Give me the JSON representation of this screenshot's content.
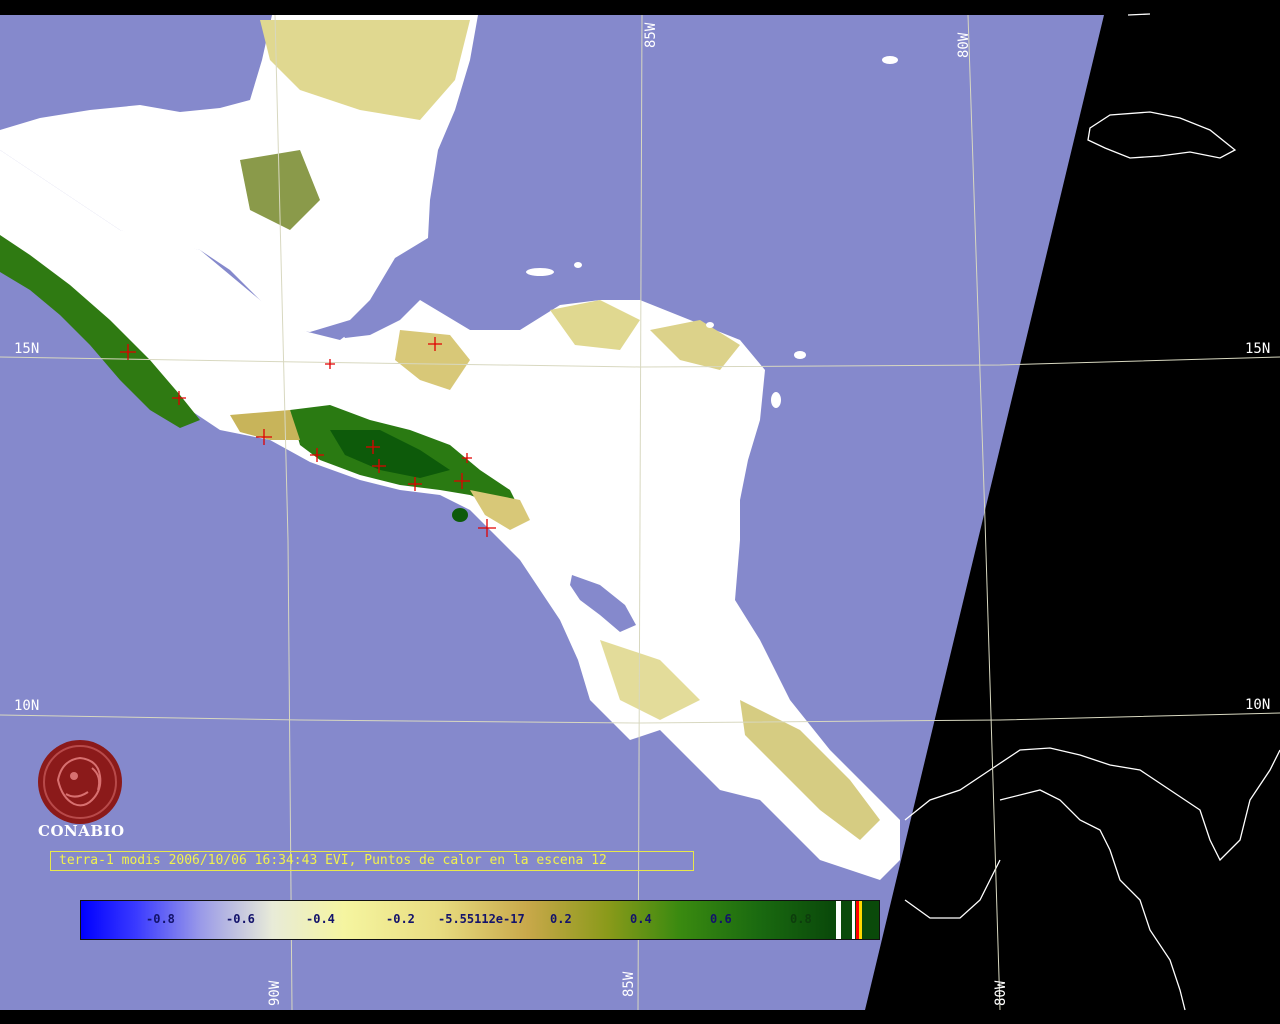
{
  "colors": {
    "ocean": "#8589cc",
    "land": "#ffffff",
    "outside_swath": "#000000",
    "gridline": "#d8d8c0",
    "caption_text": "#f2f24c",
    "hotspot": "#e00000",
    "logo": "#8b1a1a"
  },
  "grid_labels": {
    "lat_15n_left": "15N",
    "lat_15n_right": "15N",
    "lat_10n_left": "10N",
    "lat_10n_right": "10N",
    "lon_85w_top": "85W",
    "lon_80w_top": "80W",
    "lon_90w_bottom": "90W",
    "lon_85w_bottom": "85W",
    "lon_80w_bottom": "80W"
  },
  "logo": {
    "icon": "conabio-logo-icon",
    "text": "CONABIO"
  },
  "caption": "terra-1 modis 2006/10/06 16:34:43 EVI, Puntos de calor en la escena 12",
  "colorbar": {
    "ticks": [
      "-0.8",
      "-0.6",
      "-0.4",
      "-0.2",
      "-5.55112e-17",
      "0.2",
      "0.4",
      "0.6",
      "0.8"
    ]
  },
  "hotspots_count": 12
}
